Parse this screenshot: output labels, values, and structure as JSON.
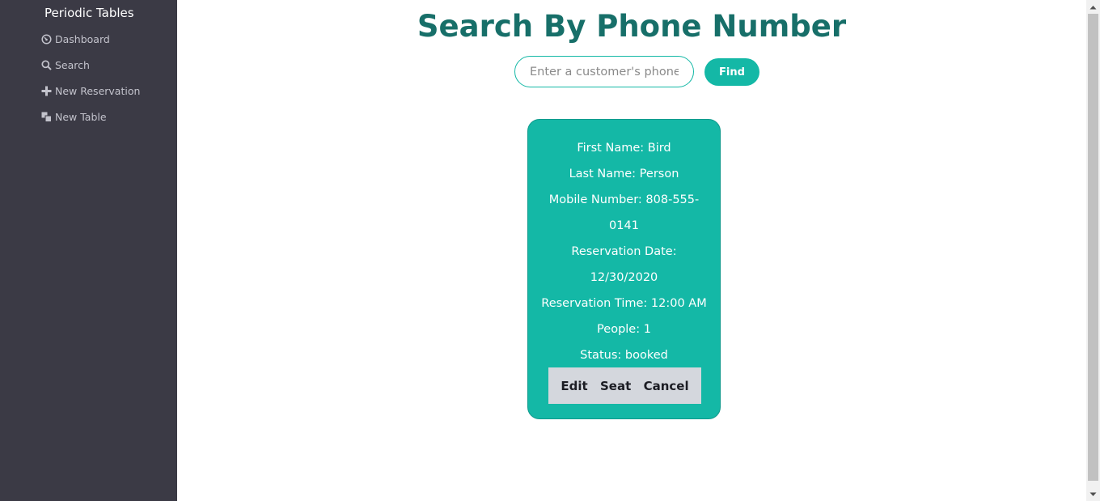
{
  "sidebar": {
    "brand": "Periodic Tables",
    "items": [
      {
        "label": "Dashboard",
        "icon": "dashboard-icon"
      },
      {
        "label": "Search",
        "icon": "search-icon"
      },
      {
        "label": "New Reservation",
        "icon": "plus-icon"
      },
      {
        "label": "New Table",
        "icon": "layers-icon"
      }
    ]
  },
  "main": {
    "title": "Search By Phone Number",
    "search": {
      "placeholder": "Enter a customer's phone number",
      "value": ""
    },
    "find_label": "Find"
  },
  "reservation": {
    "first_name": "First Name: Bird",
    "last_name": "Last Name: Person",
    "mobile": "Mobile Number: 808-555-0141",
    "date": "Reservation Date: 12/30/2020",
    "time": "Reservation Time: 12:00 AM",
    "people": "People: 1",
    "status": "Status: booked",
    "actions": {
      "edit": "Edit",
      "seat": "Seat",
      "cancel": "Cancel"
    }
  },
  "colors": {
    "sidebar_bg": "#3b3a45",
    "accent": "#14b8a6",
    "title": "#176f69",
    "actions_bg": "#d4d7dd"
  }
}
